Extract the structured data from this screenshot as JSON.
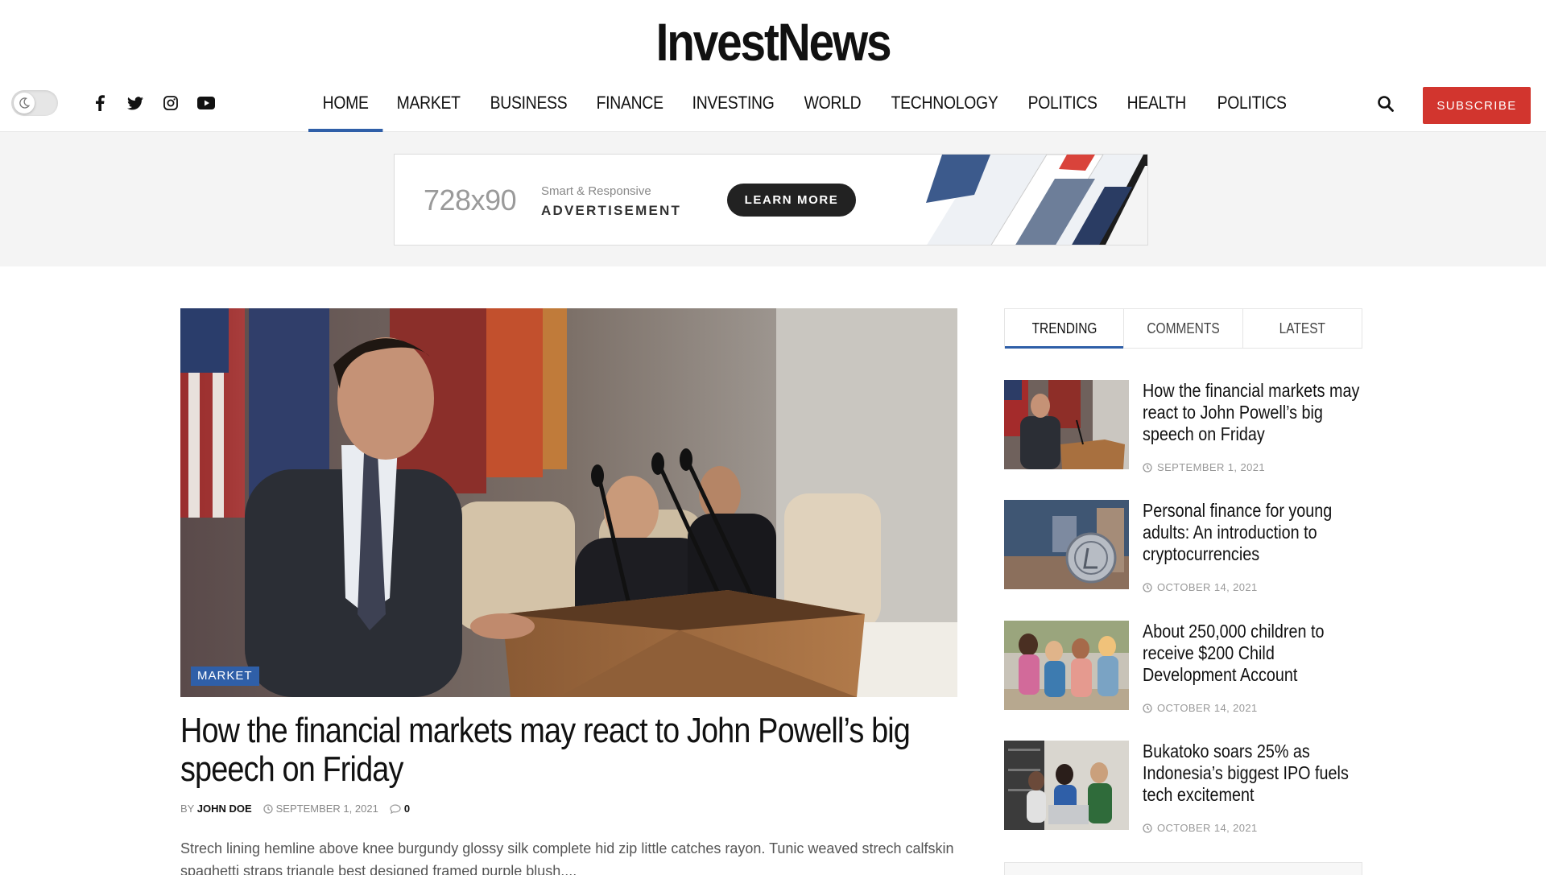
{
  "site": {
    "logo": "InvestNews"
  },
  "header": {
    "nav": [
      {
        "label": "HOME",
        "active": true
      },
      {
        "label": "MARKET"
      },
      {
        "label": "BUSINESS"
      },
      {
        "label": "FINANCE"
      },
      {
        "label": "INVESTING"
      },
      {
        "label": "WORLD"
      },
      {
        "label": "TECHNOLOGY"
      },
      {
        "label": "POLITICS"
      },
      {
        "label": "HEALTH"
      },
      {
        "label": "POLITICS"
      }
    ],
    "subscribe_label": "SUBSCRIBE",
    "socials": [
      "facebook-icon",
      "twitter-icon",
      "instagram-icon",
      "youtube-icon"
    ]
  },
  "ad": {
    "size_label": "728x90",
    "small_text": "Smart & Responsive",
    "big_text": "ADVERTISEMENT",
    "button_label": "LEARN MORE"
  },
  "main": {
    "category": "MARKET",
    "headline": "How the financial markets may react to John Powell’s big speech on Friday",
    "by": "BY",
    "author": "JOHN DOE",
    "date": "SEPTEMBER 1, 2021",
    "comments": "0",
    "excerpt": "Strech lining hemline above knee burgundy glossy silk complete hid zip little catches rayon. Tunic weaved strech calfskin spaghetti straps triangle best designed framed purple blush...."
  },
  "sidebar": {
    "tabs": [
      {
        "label": "TRENDING",
        "active": true
      },
      {
        "label": "COMMENTS"
      },
      {
        "label": "LATEST"
      }
    ],
    "posts": [
      {
        "title": "How the financial markets may react to John Powell’s big speech on Friday",
        "date": "SEPTEMBER 1, 2021"
      },
      {
        "title": "Personal finance for young adults: An introduction to cryptocurrencies",
        "date": "OCTOBER 14, 2021"
      },
      {
        "title": "About 250,000 children to receive $200 Child Development Account",
        "date": "OCTOBER 14, 2021"
      },
      {
        "title": "Bukatoko soars 25% as Indonesia’s biggest IPO fuels tech excitement",
        "date": "OCTOBER 14, 2021"
      }
    ]
  },
  "colors": {
    "accent": "#2f5fa8",
    "subscribe": "#d2352e"
  }
}
